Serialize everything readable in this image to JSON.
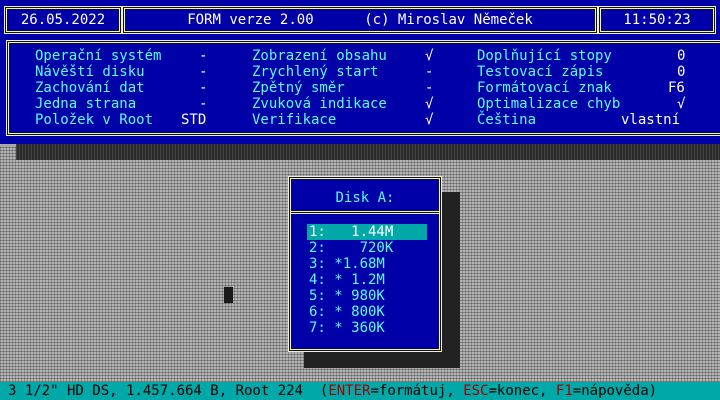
{
  "header": {
    "date": "26.05.2022",
    "title": "FORM verze 2.00",
    "copyright": "(c) Miroslav Němeček",
    "time": "11:50:23"
  },
  "settings": {
    "col1": [
      {
        "label": "Operační systém",
        "value": "-"
      },
      {
        "label": "Návěští disku",
        "value": "-"
      },
      {
        "label": "Zachování dat",
        "value": "-"
      },
      {
        "label": "Jedna strana",
        "value": "-"
      },
      {
        "label": "Položek v Root",
        "value": "STD"
      }
    ],
    "col2": [
      {
        "label": "Zobrazení obsahu",
        "value": "√"
      },
      {
        "label": "Zrychlený start",
        "value": "-"
      },
      {
        "label": "Zpětný směr",
        "value": "-"
      },
      {
        "label": "Zvuková indikace",
        "value": "√"
      },
      {
        "label": "Verifikace",
        "value": "√"
      }
    ],
    "col3": [
      {
        "label": "Doplňující stopy",
        "value": "0"
      },
      {
        "label": "Testovací zápis",
        "value": "0"
      },
      {
        "label": "Formátovací znak",
        "value": "F6"
      },
      {
        "label": "Optimalizace chyb",
        "value": "√"
      },
      {
        "label": "Čeština",
        "value": "vlastní"
      }
    ]
  },
  "dialog": {
    "title": "Disk A:",
    "options": [
      "1:   1.44M",
      "2:    720K",
      "3: *1.68M",
      "4: * 1.2M",
      "5: * 980K",
      "6: * 800K",
      "7: * 360K"
    ],
    "selected_index": 0
  },
  "status": {
    "info": "3 1/2\" HD DS, 1.457.664 B, Root 224",
    "open_paren": "(",
    "enter_key": "ENTER",
    "enter_text": "=formátuj, ",
    "esc_key": "ESC",
    "esc_text": "=konec, ",
    "f1_key": "F1",
    "f1_text": "=nápověda)"
  },
  "colors": {
    "background_blue": "#0000a8",
    "frame_yellow": "#ffff55",
    "label_cyan": "#55ffff",
    "status_cyan": "#00a8a8",
    "key_red": "#a80000"
  }
}
